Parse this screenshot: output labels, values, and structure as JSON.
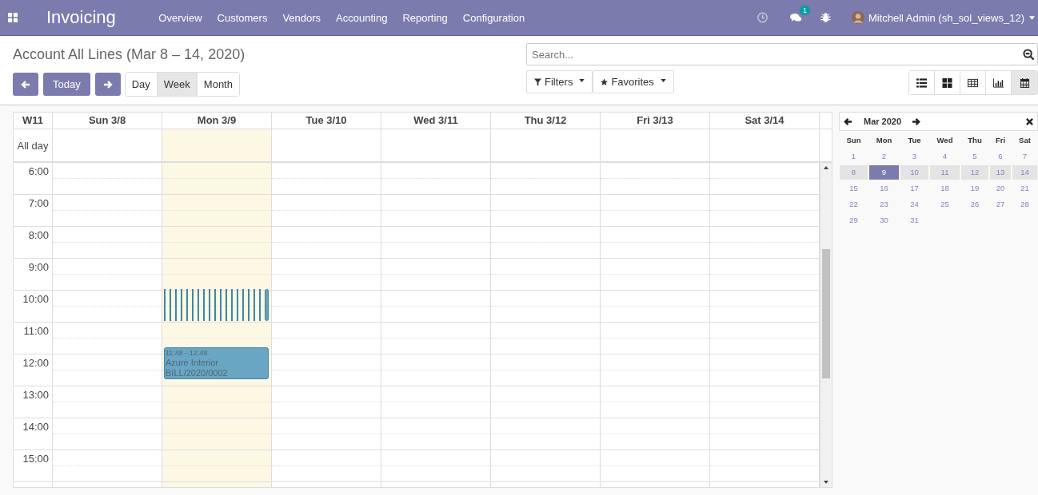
{
  "navbar": {
    "brand": "Invoicing",
    "menu": [
      "Overview",
      "Customers",
      "Vendors",
      "Accounting",
      "Reporting",
      "Configuration"
    ],
    "chat_badge": "1",
    "user": "Mitchell Admin (sh_sol_views_12)"
  },
  "title": "Account All Lines (Mar 8 – 14, 2020)",
  "nav_buttons": {
    "today": "Today"
  },
  "scales": [
    {
      "label": "Day",
      "selected": false
    },
    {
      "label": "Week",
      "selected": true
    },
    {
      "label": "Month",
      "selected": false
    }
  ],
  "search": {
    "placeholder": "Search..."
  },
  "filters": [
    "Filters",
    "Favorites"
  ],
  "views": [
    {
      "kind": "list",
      "selected": false
    },
    {
      "kind": "kanban",
      "selected": false
    },
    {
      "kind": "pivot",
      "selected": false
    },
    {
      "kind": "graph",
      "selected": false
    },
    {
      "kind": "calendar",
      "selected": true
    }
  ],
  "week": {
    "label": "W11",
    "all_day": "All day",
    "days": [
      {
        "label": "Sun 3/8",
        "today": false
      },
      {
        "label": "Mon 3/9",
        "today": true,
        "events": [
          {
            "kind": "sliver_group",
            "slivers": [
              {
                "kind": "sliver"
              },
              {
                "kind": "sliver"
              },
              {
                "kind": "sliver"
              },
              {
                "kind": "sliver"
              },
              {
                "kind": "sliver"
              },
              {
                "kind": "sliver"
              },
              {
                "kind": "sliver"
              },
              {
                "kind": "sliver"
              },
              {
                "kind": "sliver"
              },
              {
                "kind": "sliver"
              },
              {
                "kind": "sliver"
              },
              {
                "kind": "sliver"
              },
              {
                "kind": "sliver"
              },
              {
                "kind": "sliver"
              },
              {
                "kind": "sliver"
              },
              {
                "kind": "sliver"
              },
              {
                "kind": "sliver"
              },
              {
                "kind": "sliver"
              },
              {
                "kind": "pill"
              }
            ]
          },
          {
            "kind": "card",
            "time": "11:48 - 12:48",
            "partner": "Azure Interior",
            "reference": "BILL/2020/0002"
          }
        ]
      },
      {
        "label": "Tue 3/10",
        "today": false
      },
      {
        "label": "Wed 3/11",
        "today": false
      },
      {
        "label": "Thu 3/12",
        "today": false
      },
      {
        "label": "Fri 3/13",
        "today": false
      },
      {
        "label": "Sat 3/14",
        "today": false
      }
    ],
    "hours": [
      "6:00",
      "7:00",
      "8:00",
      "9:00",
      "10:00",
      "11:00",
      "12:00",
      "13:00",
      "14:00",
      "15:00"
    ]
  },
  "mini_calendar": {
    "month": "Mar 2020",
    "weekdays": [
      "Sun",
      "Mon",
      "Tue",
      "Wed",
      "Thu",
      "Fri",
      "Sat"
    ],
    "weeks": [
      [
        {
          "label": "1",
          "selected": false,
          "highlighted": false
        },
        {
          "label": "2",
          "selected": false,
          "highlighted": false
        },
        {
          "label": "3",
          "selected": false,
          "highlighted": false
        },
        {
          "label": "4",
          "selected": false,
          "highlighted": false
        },
        {
          "label": "5",
          "selected": false,
          "highlighted": false
        },
        {
          "label": "6",
          "selected": false,
          "highlighted": false
        },
        {
          "label": "7",
          "selected": false,
          "highlighted": false
        }
      ],
      [
        {
          "label": "8",
          "selected": false,
          "highlighted": true
        },
        {
          "label": "9",
          "selected": true,
          "highlighted": true
        },
        {
          "label": "10",
          "selected": false,
          "highlighted": true
        },
        {
          "label": "11",
          "selected": false,
          "highlighted": true
        },
        {
          "label": "12",
          "selected": false,
          "highlighted": true
        },
        {
          "label": "13",
          "selected": false,
          "highlighted": true
        },
        {
          "label": "14",
          "selected": false,
          "highlighted": true
        }
      ],
      [
        {
          "label": "15",
          "selected": false,
          "highlighted": false
        },
        {
          "label": "16",
          "selected": false,
          "highlighted": false
        },
        {
          "label": "17",
          "selected": false,
          "highlighted": false
        },
        {
          "label": "18",
          "selected": false,
          "highlighted": false
        },
        {
          "label": "19",
          "selected": false,
          "highlighted": false
        },
        {
          "label": "20",
          "selected": false,
          "highlighted": false
        },
        {
          "label": "21",
          "selected": false,
          "highlighted": false
        }
      ],
      [
        {
          "label": "22",
          "selected": false,
          "highlighted": false
        },
        {
          "label": "23",
          "selected": false,
          "highlighted": false
        },
        {
          "label": "24",
          "selected": false,
          "highlighted": false
        },
        {
          "label": "25",
          "selected": false,
          "highlighted": false
        },
        {
          "label": "26",
          "selected": false,
          "highlighted": false
        },
        {
          "label": "27",
          "selected": false,
          "highlighted": false
        },
        {
          "label": "28",
          "selected": false,
          "highlighted": false
        }
      ],
      [
        {
          "label": "29",
          "selected": false,
          "highlighted": false
        },
        {
          "label": "30",
          "selected": false,
          "highlighted": false
        },
        {
          "label": "31",
          "selected": false,
          "highlighted": false
        }
      ]
    ]
  }
}
